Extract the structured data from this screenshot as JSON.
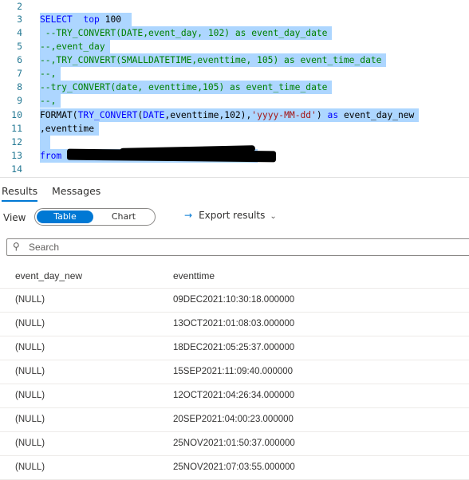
{
  "editor": {
    "lines": [
      {
        "num": "2"
      },
      {
        "num": "3"
      },
      {
        "num": "4"
      },
      {
        "num": "5"
      },
      {
        "num": "6"
      },
      {
        "num": "7"
      },
      {
        "num": "8"
      },
      {
        "num": "9"
      },
      {
        "num": "10"
      },
      {
        "num": "11"
      },
      {
        "num": "12"
      },
      {
        "num": "13"
      },
      {
        "num": "14"
      }
    ],
    "code": {
      "l3_select": "SELECT",
      "l3_top": "top",
      "l3_num": "100",
      "l4": " --TRY_CONVERT(DATE,event_day, 102) as event_day_date",
      "l5": "--,event_day",
      "l6": "--,TRY_CONVERT(SMALLDATETIME,eventtime, 105) as event_time_date",
      "l7": "--,",
      "l8": "--try_CONVERT(date, eventtime,105) as event_time_date",
      "l9": "--,",
      "l10_fn": "FORMAT(",
      "l10_try": "TRY_CONVERT",
      "l10_args_open": "(",
      "l10_date": "DATE",
      "l10_args": ",eventtime,102),",
      "l10_str": "'yyyy-MM-dd'",
      "l10_paren": ") ",
      "l10_as": "as",
      "l10_alias": " event_day_new",
      "l11": ",eventtime",
      "l13_from": "from"
    }
  },
  "tabs": {
    "results": "Results",
    "messages": "Messages"
  },
  "viewbar": {
    "view_label": "View",
    "table": "Table",
    "chart": "Chart",
    "export": "Export results",
    "export_icon": "→"
  },
  "search": {
    "placeholder": "Search",
    "icon": "search-icon"
  },
  "grid": {
    "columns": [
      "event_day_new",
      "eventtime"
    ],
    "rows": [
      [
        "(NULL)",
        "09DEC2021:10:30:18.000000"
      ],
      [
        "(NULL)",
        "13OCT2021:01:08:03.000000"
      ],
      [
        "(NULL)",
        "18DEC2021:05:25:37.000000"
      ],
      [
        "(NULL)",
        "15SEP2021:11:09:40.000000"
      ],
      [
        "(NULL)",
        "12OCT2021:04:26:34.000000"
      ],
      [
        "(NULL)",
        "20SEP2021:04:00:23.000000"
      ],
      [
        "(NULL)",
        "25NOV2021:01:50:37.000000"
      ],
      [
        "(NULL)",
        "25NOV2021:07:03:55.000000"
      ]
    ]
  }
}
